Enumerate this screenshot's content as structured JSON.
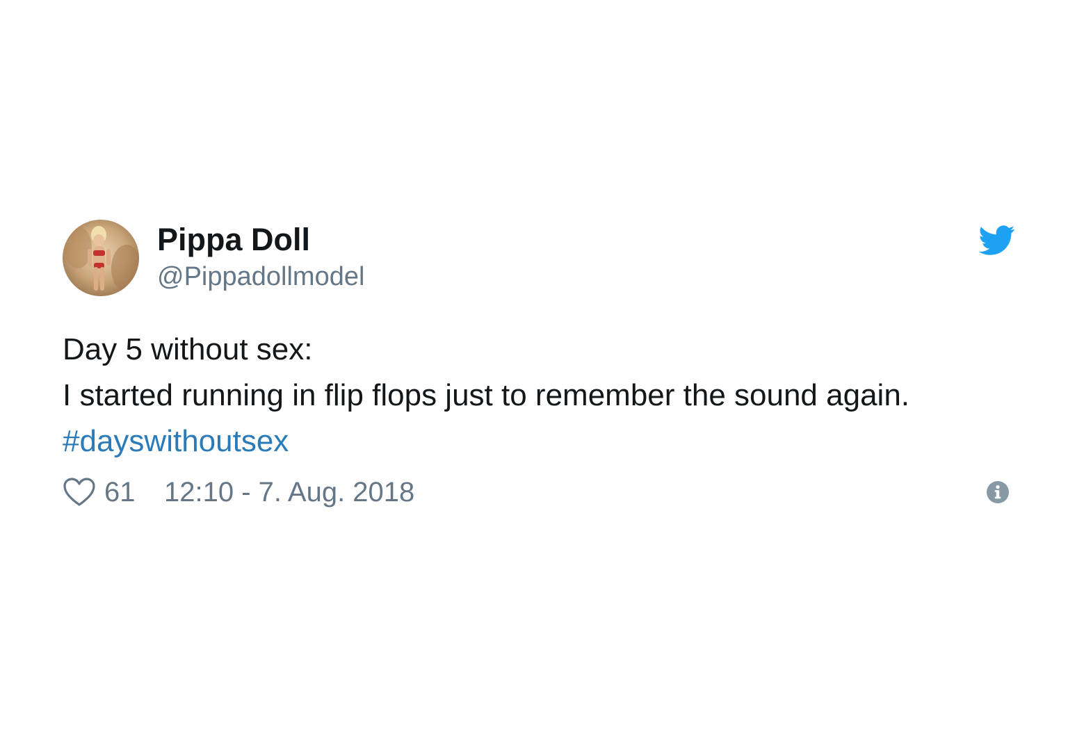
{
  "tweet": {
    "author": {
      "display_name": "Pippa Doll",
      "handle": "@Pippadollmodel",
      "avatar": "avatar-photo"
    },
    "brand_icon": "twitter-bird-icon",
    "text_lines": [
      "Day 5 without sex:",
      "I started running in flip flops just to remember the sound again."
    ],
    "hashtag": "#dayswithoutsex",
    "likes": {
      "icon": "heart-icon",
      "count": "61"
    },
    "timestamp": "12:10 - 7. Aug. 2018",
    "info_icon": "info-icon"
  },
  "colors": {
    "text": "#14171a",
    "secondary": "#657786",
    "link": "#2b7bb9",
    "brand": "#1da1f2",
    "background": "#ffffff"
  }
}
